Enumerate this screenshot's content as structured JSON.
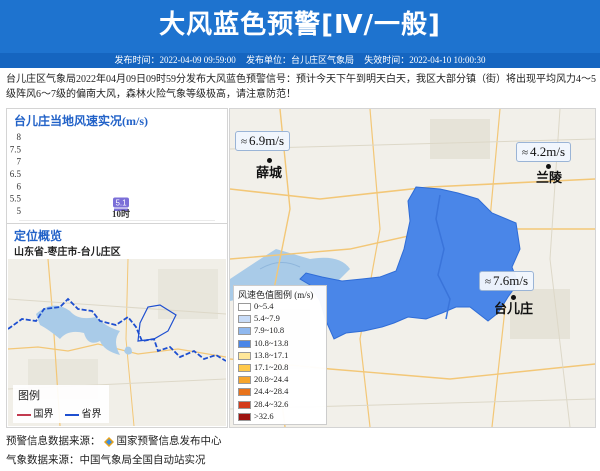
{
  "header": {
    "title": "大风蓝色预警[Ⅳ/一般]",
    "publish_time": "发布时间：2022-04-09 09:59:00",
    "publisher": "发布单位：台儿庄区气象局",
    "expire_time": "失效时间：2022-04-10 10:00:30",
    "bg_color": "#1e73cf"
  },
  "description": "台儿庄区气象局2022年04月09日09时59分发布大风蓝色预警信号：预计今天下午到明天白天，我区大部分镇（街）将出现平均风力4～5级阵风6～7级的偏南大风，森林火险气象等级极高，请注意防范！",
  "wind_panel": {
    "title": "台儿庄当地风速实况(m/s)"
  },
  "chart_data": {
    "type": "bar",
    "title": "台儿庄当地风速实况(m/s)",
    "categories": [
      "10时"
    ],
    "values": [
      5.1
    ],
    "data_labels": [
      "5.1"
    ],
    "yticks": [
      "8",
      "7.5",
      "7",
      "6.5",
      "6",
      "5.5",
      "5"
    ],
    "ylim": [
      5,
      8
    ],
    "xlabel": "",
    "ylabel": "",
    "bar_color": "#7b6fd8"
  },
  "location": {
    "title": "定位概览",
    "path": "山东省-枣庄市-台儿庄区",
    "legend_title": "图例",
    "legend_items": [
      {
        "label": "国界",
        "color": "#c23a4f"
      },
      {
        "label": "省界",
        "color": "#1e4fd0"
      }
    ]
  },
  "map": {
    "stations": [
      {
        "value": "6.9m/s",
        "icon": "wind-icon"
      },
      {
        "value": "4.2m/s",
        "icon": "wind-icon"
      },
      {
        "value": "7.6m/s",
        "icon": "wind-icon"
      }
    ],
    "cities": [
      "薛城",
      "兰陵",
      "台儿庄"
    ],
    "scale_title": "风速色值图例 (m/s)",
    "scale": [
      {
        "label": "0~5.4",
        "color": "#ffffff"
      },
      {
        "label": "5.4~7.9",
        "color": "#c8dcf8"
      },
      {
        "label": "7.9~10.8",
        "color": "#8fb8ef"
      },
      {
        "label": "10.8~13.8",
        "color": "#4a86e8"
      },
      {
        "label": "13.8~17.1",
        "color": "#ffe79a"
      },
      {
        "label": "17.1~20.8",
        "color": "#ffc94a"
      },
      {
        "label": "20.8~24.4",
        "color": "#f7a52c"
      },
      {
        "label": "24.4~28.4",
        "color": "#e8731b"
      },
      {
        "label": "28.4~32.6",
        "color": "#d33b1a"
      },
      {
        "label": ">32.6",
        "color": "#9e1410"
      }
    ],
    "warning_area_color": "#4a86e8"
  },
  "footer": {
    "source1_label": "预警信息数据来源：",
    "source1_name": "国家预警信息发布中心",
    "source2": "气象数据来源：中国气象局全国自动站实况"
  }
}
